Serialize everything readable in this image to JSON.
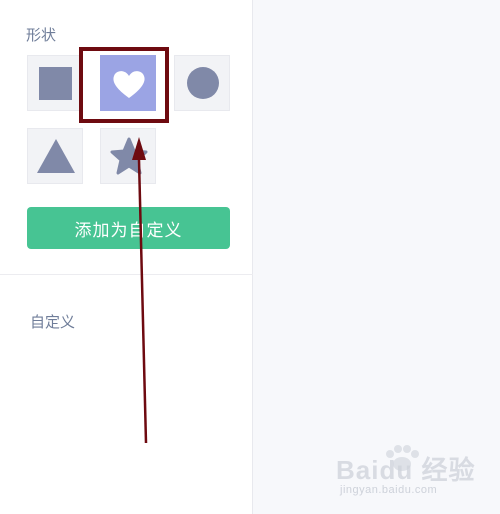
{
  "panel": {
    "shapes_title": "形状",
    "shapes": [
      {
        "id": "square",
        "icon": "square-icon",
        "selected": false
      },
      {
        "id": "heart",
        "icon": "heart-icon",
        "selected": true
      },
      {
        "id": "circle",
        "icon": "circle-icon",
        "selected": false
      },
      {
        "id": "triangle",
        "icon": "triangle-icon",
        "selected": false
      },
      {
        "id": "star",
        "icon": "star-icon",
        "selected": false
      }
    ],
    "add_button_label": "添加为自定义",
    "custom_title": "自定义"
  },
  "watermark": {
    "main": "Baidu 经验",
    "sub": "jingyan.baidu.com"
  },
  "colors": {
    "shape_fill": "#8089a8",
    "selected_tile": "#9ba4e4",
    "button_green": "#47c493",
    "annotation_red": "#6e0a10"
  }
}
